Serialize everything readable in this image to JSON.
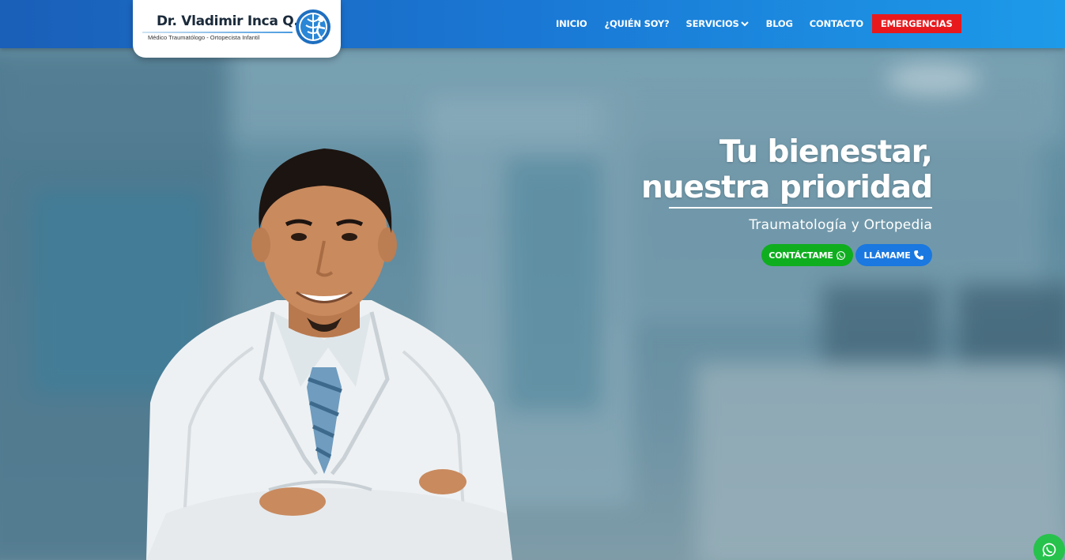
{
  "logo": {
    "name": "Dr. Vladimir Inca Q.",
    "subtitle": "Médico Traumatólogo - Ortopecista Infantil"
  },
  "nav": {
    "items": [
      {
        "label": "INICIO"
      },
      {
        "label": "¿QUIÉN SOY?"
      },
      {
        "label": "SERVICIOS"
      },
      {
        "label": "BLOG"
      },
      {
        "label": "CONTACTO"
      }
    ],
    "emergency_label": "EMERGENCIAS"
  },
  "hero": {
    "title_line1": "Tu bienestar,",
    "title_line2": "nuestra prioridad",
    "subtitle": "Traumatología y Ortopedia",
    "contact_button": "CONTÁCTAME",
    "call_button": "LLÁMAME"
  },
  "colors": {
    "header_start": "#1a5fb8",
    "header_end": "#1d9ae9",
    "emergency": "#e8191d",
    "contact_button": "#0fae1f",
    "call_button": "#1a78e0",
    "whatsapp": "#27c24c"
  },
  "icons": [
    "doctor-emblem-icon",
    "chevron-down-icon",
    "whatsapp-icon",
    "phone-icon"
  ]
}
